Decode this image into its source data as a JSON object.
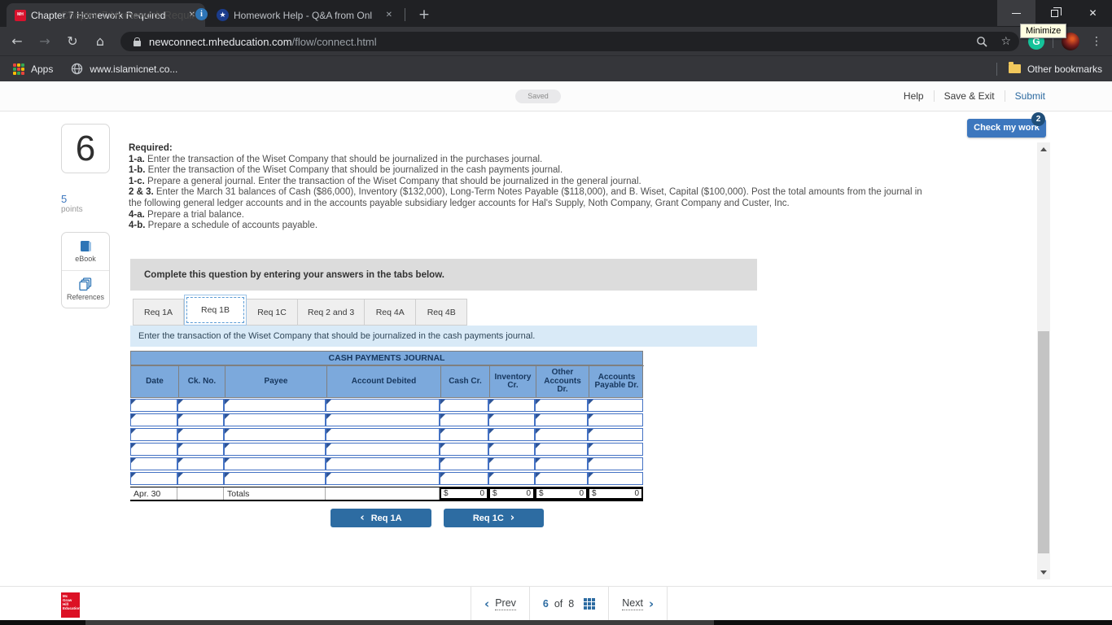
{
  "browser": {
    "tab1_title": "Chapter 7 Homework Required",
    "tab2_title": "Homework Help - Q&A from Onl",
    "tooltip": "Minimize",
    "url_domain": "newconnect.mheducation.com",
    "url_path": "/flow/connect.html",
    "apps_label": "Apps",
    "bookmark_label": "www.islamicnet.co...",
    "other_bookmarks_label": "Other bookmarks"
  },
  "icons": {
    "back": "←",
    "forward": "→",
    "reload": "↻",
    "home": "⌂",
    "star_outline": "☆",
    "menu": "⋮",
    "close": "✕",
    "plus": "+",
    "grammarly_g": "G",
    "star_filled": "★",
    "info": "i",
    "chevron_left": "‹",
    "chevron_right": "›",
    "mh_favicon_text": "MH"
  },
  "header": {
    "title": "Chapter 7 Homework Required",
    "saved_badge": "Saved",
    "help": "Help",
    "save_exit": "Save & Exit",
    "submit": "Submit",
    "check_my_work": "Check my work",
    "check_badge": "2"
  },
  "sidebar": {
    "question_number": "6",
    "points_value": "5",
    "points_label": "points",
    "ebook_label": "eBook",
    "references_label": "References"
  },
  "required": {
    "heading": "Required:",
    "items": [
      {
        "label": "1-a.",
        "text": "Enter the transaction of the Wiset Company that should be journalized in the purchases journal."
      },
      {
        "label": "1-b.",
        "text": "Enter the transaction of the Wiset Company that should be journalized in the cash payments journal."
      },
      {
        "label": "1-c.",
        "text": "Prepare a general journal. Enter the transaction of the Wiset Company that should be journalized in the general journal."
      },
      {
        "label": "2 & 3.",
        "text": "Enter the March 31 balances of Cash ($86,000), Inventory ($132,000), Long-Term Notes Payable ($118,000), and B. Wiset, Capital ($100,000). Post the total amounts from the journal in the following general ledger accounts and in the accounts payable subsidiary ledger accounts for Hal's Supply, Noth Company, Grant Company and Custer, Inc."
      },
      {
        "label": "4-a.",
        "text": "Prepare a trial balance."
      },
      {
        "label": "4-b.",
        "text": "Prepare a schedule of accounts payable."
      }
    ]
  },
  "question": {
    "banner": "Complete this question by entering your answers in the tabs below.",
    "tabs": [
      {
        "label": "Req 1A"
      },
      {
        "label": "Req 1B"
      },
      {
        "label": "Req 1C"
      },
      {
        "label": "Req 2 and 3"
      },
      {
        "label": "Req 4A"
      },
      {
        "label": "Req 4B"
      }
    ],
    "active_tab": "Req 1B",
    "instruction": "Enter the transaction of the Wiset Company that should be journalized in the cash payments journal."
  },
  "journal": {
    "title": "CASH PAYMENTS JOURNAL",
    "columns": [
      "Date",
      "Ck. No.",
      "Payee",
      "Account Debited",
      "Cash Cr.",
      "Inventory Cr.",
      "Other Accounts Dr.",
      "Accounts Payable Dr."
    ],
    "empty_row_count": 6,
    "totals": {
      "date": "Apr. 30",
      "label": "Totals",
      "currency": "$",
      "values": [
        "0",
        "0",
        "0",
        "0"
      ]
    }
  },
  "nav": {
    "prev_label": "Req 1A",
    "next_label": "Req 1C"
  },
  "footer": {
    "logo_lines": [
      "Mc",
      "Graw",
      "Hill",
      "Education"
    ],
    "prev": "Prev",
    "page_current": "6",
    "page_of": "of",
    "page_total": "8",
    "next": "Next"
  },
  "colors": {
    "accent_blue": "#2D6CA2",
    "check_button": "#3D77BE",
    "badge_navy": "#1F4E79",
    "table_header_blue": "#7CA9DC",
    "table_header_text": "#17375E",
    "cell_border_blue": "#4472C4",
    "instruction_bg": "#D9EAF7",
    "banner_bg": "#DCDCDC",
    "grammarly_green": "#15C39A",
    "mcgraw_red": "#DC1125"
  }
}
